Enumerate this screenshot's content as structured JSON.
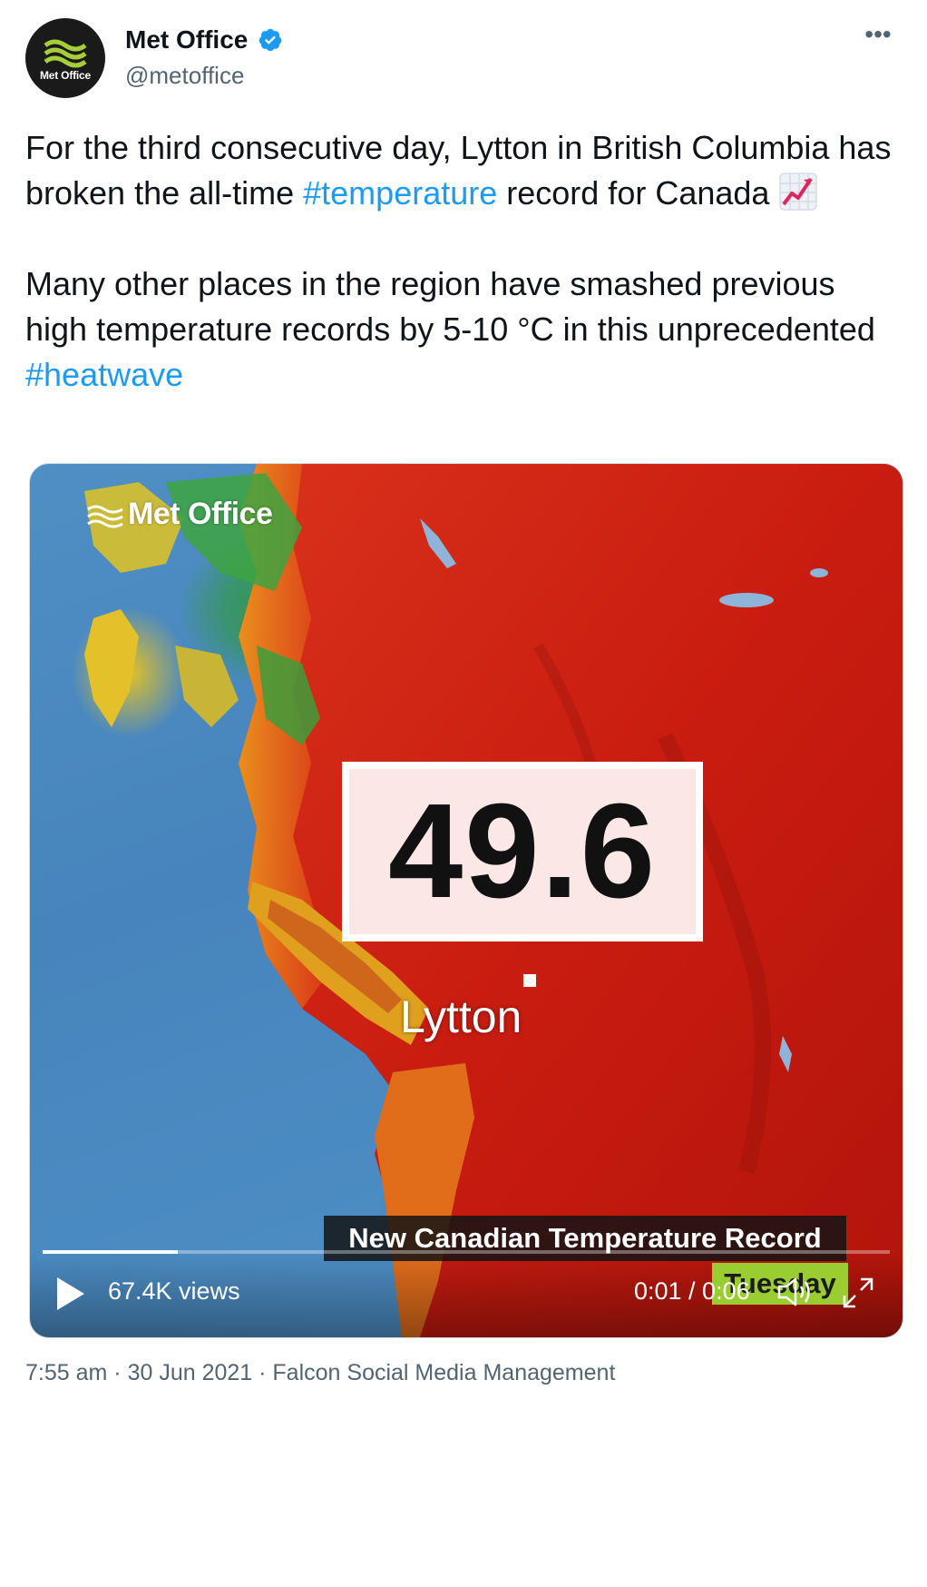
{
  "author": {
    "display_name": "Met Office",
    "handle": "@metoffice",
    "avatar_text": "Met Office",
    "verified": true
  },
  "tweet": {
    "paragraph1_part1": "For the third consecutive day, Lytton in British Columbia has broken the all-time ",
    "hashtag1": "#temperature",
    "paragraph1_part2": " record for Canada",
    "emoji": "chart-increasing-emoji",
    "paragraph2_part1": "Many other places in the region have smashed previous high temperature records by 5-10 °C in this unprecedented ",
    "hashtag2": "#heatwave"
  },
  "video": {
    "wordmark": "Met Office",
    "temperature_value": "49.6",
    "location_label": "Lytton",
    "banner_title": "New Canadian Temperature Record",
    "day_label": "Tuesday",
    "views": "67.4K views",
    "time_display": "0:01 / 0:06",
    "progress_fraction": 0.16,
    "play_icon": "play-icon",
    "volume_icon": "volume-icon",
    "fullscreen_icon": "fullscreen-icon"
  },
  "meta": {
    "time": "7:55 am",
    "separator": " · ",
    "date": "30 Jun 2021",
    "source": "Falcon Social Media Management"
  },
  "colors": {
    "hashtag": "#1d9bf0",
    "secondary_text": "#536471",
    "verified": "#1d9bf0",
    "day_label_bg": "#9acd32"
  }
}
